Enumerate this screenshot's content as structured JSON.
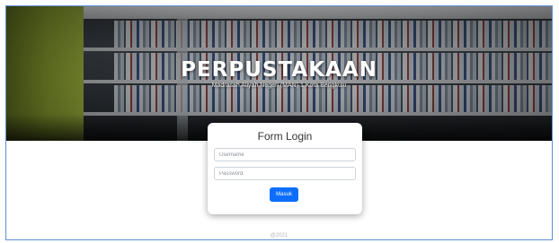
{
  "header": {
    "title": "PERPUSTAKAAN",
    "subtitle": "Madrasah Aliyah Negeri (MAN) 1 Kota Bengkulu"
  },
  "login": {
    "title": "Form Login",
    "username_placeholder": "Username",
    "username_value": "",
    "password_placeholder": "Password",
    "password_value": "",
    "submit_label": "Masuk"
  },
  "footer": {
    "copyright": "@2021"
  },
  "colors": {
    "accent": "#0d6efd",
    "frame_border": "#5b8fd6"
  }
}
